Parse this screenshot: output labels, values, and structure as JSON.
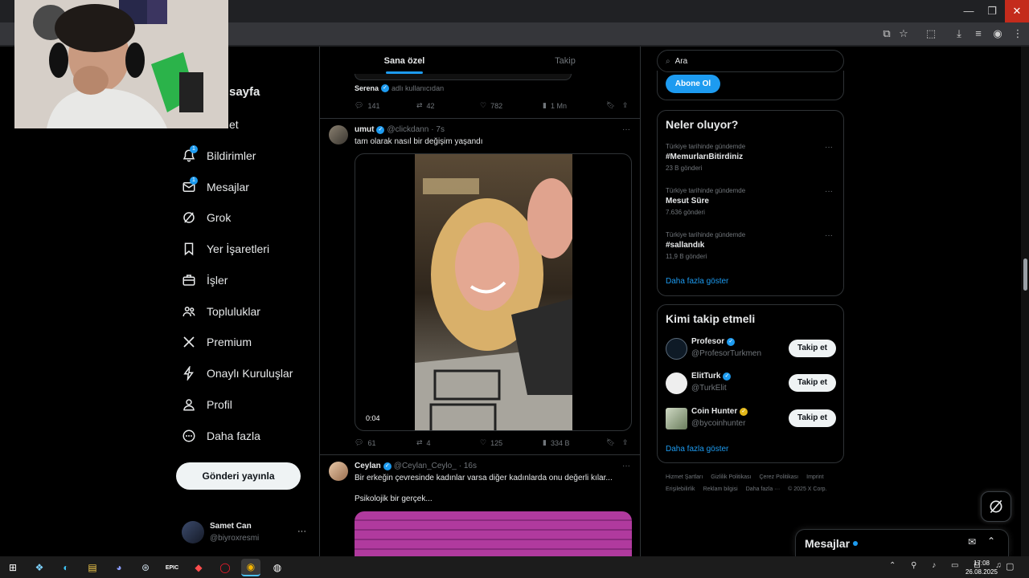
{
  "window": {
    "minimize": "—",
    "maximize": "❐",
    "close": "✕"
  },
  "nav": {
    "partial_home": "sayfa",
    "partial_explore": "et",
    "items": [
      {
        "label": "Bildirimler",
        "badge": "1"
      },
      {
        "label": "Mesajlar",
        "badge": "1"
      },
      {
        "label": "Grok"
      },
      {
        "label": "Yer İşaretleri"
      },
      {
        "label": "İşler"
      },
      {
        "label": "Topluluklar"
      },
      {
        "label": "Premium"
      },
      {
        "label": "Onaylı Kuruluşlar"
      },
      {
        "label": "Profil"
      },
      {
        "label": "Daha fazla"
      }
    ],
    "post_button": "Gönderi yayınla",
    "account": {
      "name": "Samet Can",
      "handle": "@biyroxresmi",
      "more": "···"
    }
  },
  "feed": {
    "tabs": [
      {
        "label": "Sana özel",
        "active": true
      },
      {
        "label": "Takip",
        "active": false
      }
    ],
    "prev_post": {
      "reposter_name": "Serena",
      "reposter_suffix": "adlı kullanıcıdan",
      "stats": {
        "replies": "141",
        "reposts": "42",
        "likes": "782",
        "views": "1 Mn"
      }
    },
    "post1": {
      "name": "umut",
      "handle": "@clickdann",
      "time": "· 7s",
      "text": "tam olarak nasıl bir değişim yaşandı",
      "video_time": "0:04",
      "more": "···",
      "stats": {
        "replies": "61",
        "reposts": "4",
        "likes": "125",
        "views": "334 B"
      }
    },
    "post2": {
      "name": "Ceylan",
      "handle": "@Ceylan_Ceylo_",
      "time": "· 16s",
      "text": "Bir erkeğin çevresinde kadınlar varsa diğer kadınlarda onu değerli kılar...",
      "text2": "Psikolojik bir gerçek...",
      "more": "···"
    }
  },
  "right": {
    "search_placeholder": "Ara",
    "subscribe_button": "Abone Ol",
    "trends": {
      "title": "Neler oluyor?",
      "items": [
        {
          "meta": "Türkiye tarihinde gündemde",
          "title": "#MemurlarıBitirdiniz",
          "count": "23 B gönderi"
        },
        {
          "meta": "Türkiye tarihinde gündemde",
          "title": "Mesut Süre",
          "count": "7.636 gönderi"
        },
        {
          "meta": "Türkiye tarihinde gündemde",
          "title": "#sallandık",
          "count": "11,9 B gönderi"
        }
      ],
      "more": "Daha fazla göster",
      "dots": "···"
    },
    "who_to_follow": {
      "title": "Kimi takip etmeli",
      "accounts": [
        {
          "name": "Profesor",
          "handle": "@ProfesorTurkmen",
          "button": "Takip et",
          "badge": "blue"
        },
        {
          "name": "ElitTurk",
          "handle": "@TurkElit",
          "button": "Takip et",
          "badge": "blue"
        },
        {
          "name": "Coin Hunter",
          "handle": "@bycoinhunter",
          "button": "Takip et",
          "badge": "gold"
        }
      ],
      "more": "Daha fazla göster"
    },
    "footer": {
      "links": [
        "Hizmet Şartları",
        "Gizlilik Politikası",
        "Çerez Politikası",
        "Imprint",
        "Erişilebilirlik",
        "Reklam bilgisi",
        "Daha fazla ···",
        "© 2025 X Corp."
      ]
    }
  },
  "messages_drawer": {
    "title": "Mesajlar"
  },
  "taskbar": {
    "apps": [
      "windows",
      "copilot",
      "edge",
      "explorer",
      "discord",
      "steam",
      "epic",
      "app-red",
      "opera",
      "chrome",
      "obs"
    ],
    "epic_label": "EPIC",
    "time": "17:08",
    "date": "26.08.2025"
  },
  "colors": {
    "accent": "#1d9bf0",
    "background": "#000000",
    "text": "#e7e9ea",
    "muted": "#71767b",
    "close_red": "#c42b1c"
  }
}
